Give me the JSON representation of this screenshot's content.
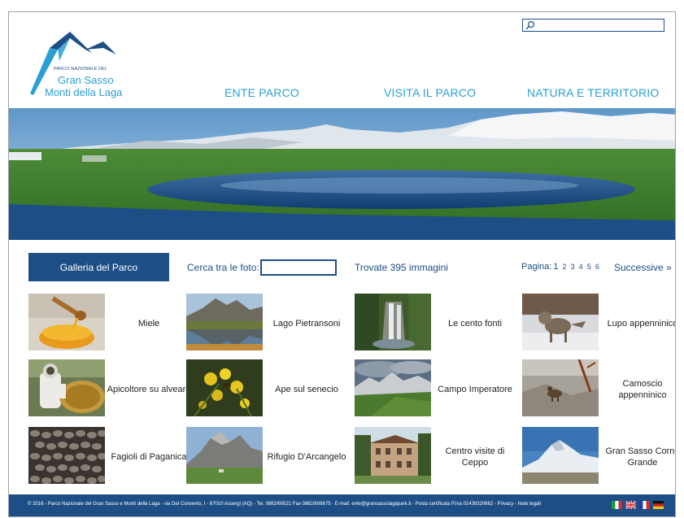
{
  "header": {
    "search_placeholder": "",
    "logo": {
      "small": "PARCO NAZIONALE DEL",
      "line1": "Gran Sasso",
      "line2": "Monti della Laga"
    },
    "nav": [
      "ENTE PARCO",
      "VISITA IL PARCO",
      "NATURA E TERRITORIO"
    ]
  },
  "gallery": {
    "title": "Galleria del Parco",
    "search_label": "Cerca tra le foto:",
    "search_value": "",
    "found": "Trovate 395 immagini",
    "pager_label": "Pagina:",
    "pages": [
      "1",
      "2",
      "3",
      "4",
      "5",
      "6"
    ],
    "current_page": "1",
    "next": "Successive »",
    "items": [
      [
        "Miele",
        "Lago Pietransoni",
        "Le cento fonti",
        "Lupo appenninico"
      ],
      [
        "Apicoltore su alveare",
        "Ape sul senecio",
        "Campo Imperatore",
        "Camoscio appenninico"
      ],
      [
        "Fagioli di Paganica",
        "Rifugio D'Arcangelo",
        "Centro visite di Ceppo",
        "Gran Sasso Corno Grande"
      ]
    ]
  },
  "footer": {
    "text": "© 2016 - Parco Nazionale del Gran Sasso e Monti della Laga - via Del Convento, I - 67010 Assergi (AQ) - Tel. 0862/60521 Fax 0862/606675 - E-mail: ente@gransassolagapark.it - Posta certificata P.Iva 01439320662 - Privacy - Note legali",
    "flags": [
      "italian-flag-icon",
      "uk-flag-icon",
      "french-flag-icon",
      "german-flag-icon"
    ]
  },
  "colors": {
    "brand_blue": "#1d4f86",
    "accent_cyan": "#2a9fd4"
  }
}
